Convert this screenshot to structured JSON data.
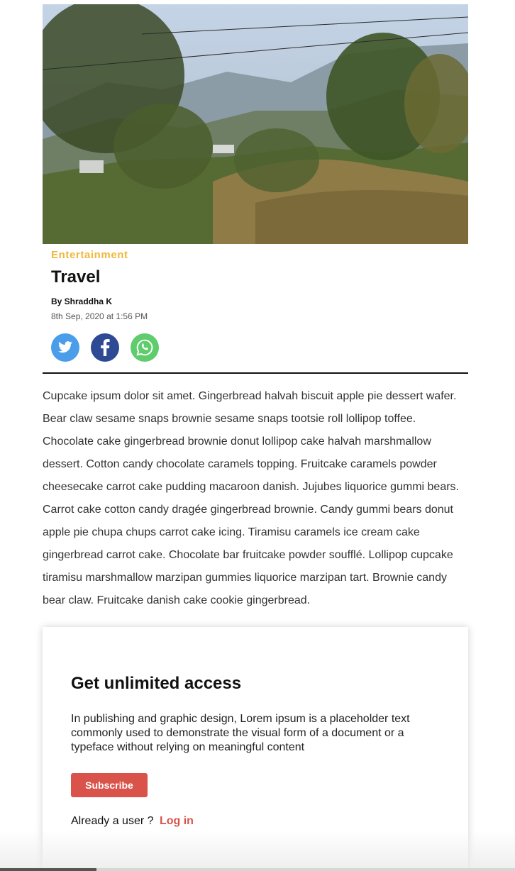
{
  "article": {
    "hero_alt": "hillside landscape photo",
    "category": "Entertainment",
    "title": "Travel",
    "byline": "By Shraddha K",
    "date": "8th Sep, 2020 at 1:56 PM",
    "body": "Cupcake ipsum dolor sit amet. Gingerbread halvah biscuit apple pie dessert wafer. Bear claw sesame snaps brownie sesame snaps tootsie roll lollipop toffee. Chocolate cake gingerbread brownie donut lollipop cake halvah marshmallow dessert. Cotton candy chocolate caramels topping. Fruitcake caramels powder cheesecake carrot cake pudding macaroon danish. Jujubes liquorice gummi bears. Carrot cake cotton candy dragée gingerbread brownie. Candy gummi bears donut apple pie chupa chups carrot cake icing. Tiramisu caramels ice cream cake gingerbread carrot cake. Chocolate bar fruitcake powder soufflé. Lollipop cupcake tiramisu marshmallow marzipan gummies liquorice marzipan tart. Brownie candy bear claw. Fruitcake danish cake cookie gingerbread."
  },
  "share": {
    "icons": [
      "twitter-icon",
      "facebook-icon",
      "whatsapp-icon"
    ],
    "colors": {
      "twitter": "#4a9ee9",
      "facebook": "#2e4a94",
      "whatsapp": "#5fcc6d"
    }
  },
  "paywall": {
    "title": "Get unlimited access",
    "text": "In publishing and graphic design, Lorem ipsum is a placeholder text commonly used to demonstrate the visual form of a document or a typeface without relying on meaningful content",
    "subscribe_label": "Subscribe",
    "already_user": "Already a user ?",
    "login_label": "Log in"
  },
  "colors": {
    "category": "#f0b83a",
    "accent": "#d9534b"
  }
}
